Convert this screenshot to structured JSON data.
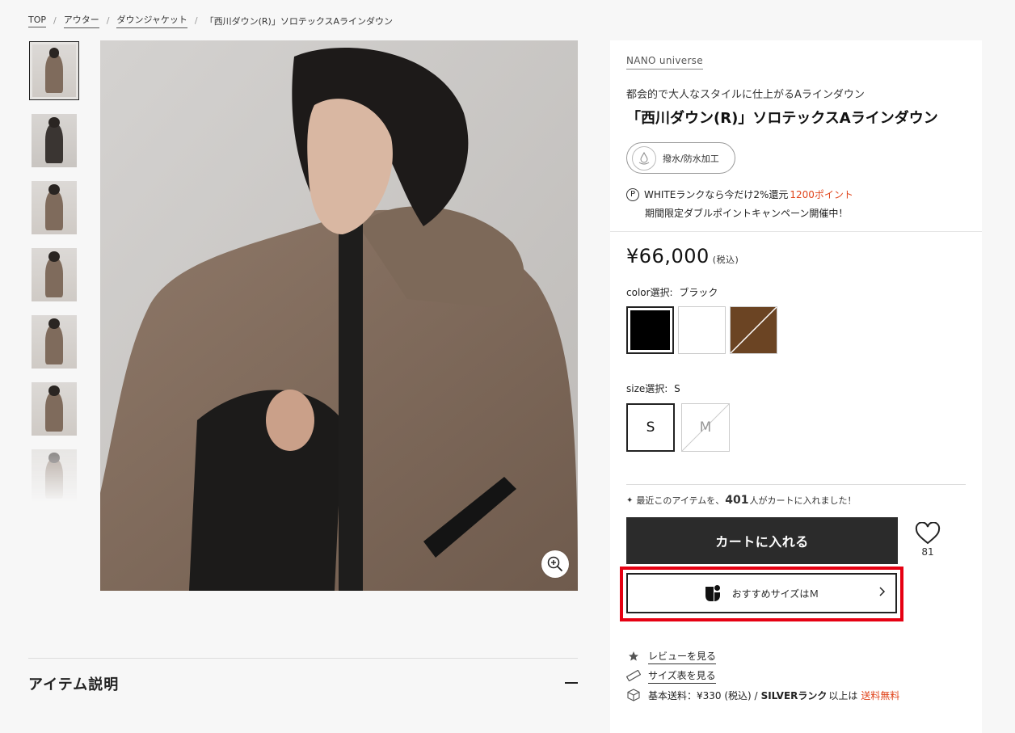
{
  "breadcrumb": [
    "TOP",
    "アウター",
    "ダウンジャケット",
    "「西川ダウン(R)」ソロテックスAラインダウン"
  ],
  "separator": "/",
  "description_title": "アイテム説明",
  "product": {
    "brand": "NANO universe",
    "subtitle": "都会的で大人なスタイルに仕上がるAラインダウン",
    "title": "「西川ダウン(R)」ソロテックスAラインダウン",
    "feature_badge": "撥水/防水加工",
    "points_prefix": "WHITEランクなら今だけ2%還元",
    "points_value": "1200ポイント",
    "points_line2": "期間限定ダブルポイントキャンペーン開催中！",
    "price": "¥66,000",
    "tax": "(税込)",
    "color_label": "color選択:",
    "color_selected": "ブラック",
    "colors": [
      "#000000",
      "#ffffff",
      "#6b4423"
    ],
    "size_label": "size選択:",
    "size_selected": "S",
    "sizes": [
      "S",
      "M"
    ],
    "recent_prefix": "最近このアイテムを、",
    "recent_count": "401",
    "recent_suffix": "人がカートに入れました！",
    "cart_button": "カートに入れる",
    "favorite_count": "81",
    "size_recommend": "おすすめサイズはＭ",
    "review_link": "レビューを見る",
    "size_chart_link": "サイズ表を見る",
    "shipping_prefix": "基本送料：¥330 (税込) /",
    "shipping_rank": "SILVERランク",
    "shipping_mid": "以上は",
    "shipping_free": "送料無料"
  },
  "accent_color": "#e0451c",
  "highlight_color": "#e60012"
}
